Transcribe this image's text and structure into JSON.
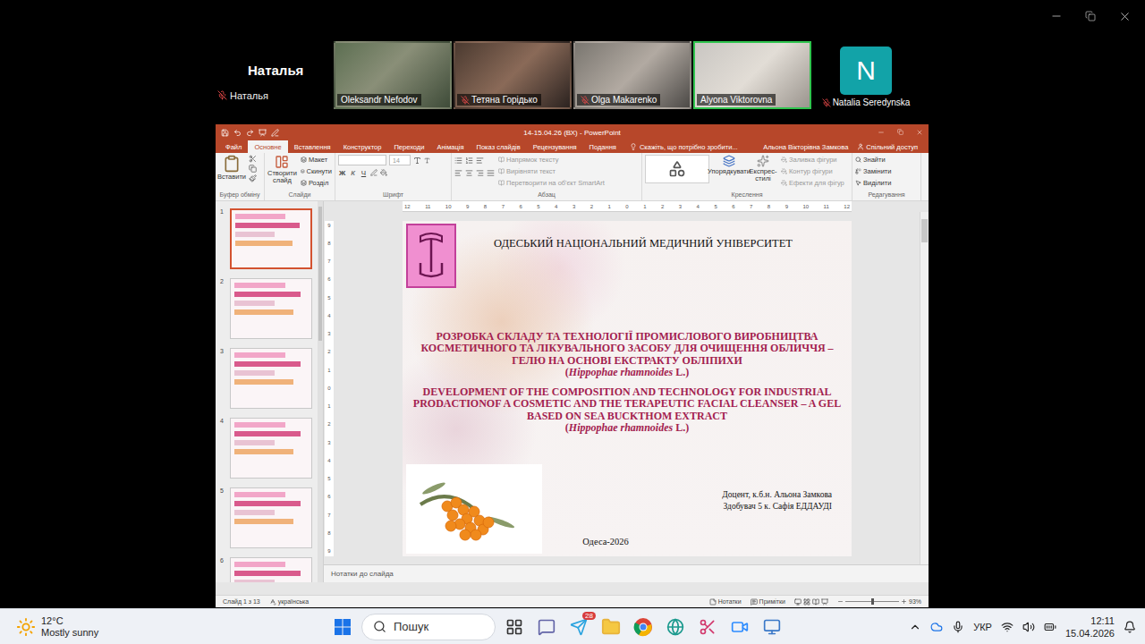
{
  "host": {
    "name": "Наталья",
    "label": "Наталья",
    "muted": true
  },
  "participants": [
    {
      "name": "Oleksandr Nefodov",
      "kind": "video",
      "muted": false,
      "speaking": false
    },
    {
      "name": "Тетяна Горідько",
      "kind": "video",
      "muted": true,
      "speaking": false
    },
    {
      "name": "Olga Makarenko",
      "kind": "video",
      "muted": true,
      "speaking": false
    },
    {
      "name": "Alyona Viktorovna",
      "kind": "video",
      "muted": false,
      "speaking": true
    },
    {
      "name": "Natalia Seredynska",
      "kind": "avatar",
      "initial": "N",
      "muted": true,
      "speaking": false
    }
  ],
  "powerpoint": {
    "title": "14-15.04.26 (ВХ) - PowerPoint",
    "tabs": [
      {
        "label": "Файл",
        "selected": false
      },
      {
        "label": "Основне",
        "selected": true
      },
      {
        "label": "Вставлення",
        "selected": false
      },
      {
        "label": "Конструктор",
        "selected": false
      },
      {
        "label": "Переходи",
        "selected": false
      },
      {
        "label": "Анімація",
        "selected": false
      },
      {
        "label": "Показ слайдів",
        "selected": false
      },
      {
        "label": "Рецензування",
        "selected": false
      },
      {
        "label": "Подання",
        "selected": false
      }
    ],
    "tell_me": "Скажіть, що потрібно зробити...",
    "user": "Альона Вікторівна Замкова",
    "share": "Спільний доступ",
    "ribbon": {
      "clipboard": {
        "label": "Буфер обміну",
        "paste": "Вставити"
      },
      "slides": {
        "label": "Слайди",
        "new_slide": "Створити слайд",
        "items": [
          {
            "label": "Макет",
            "disabled": false
          },
          {
            "label": "Скинути",
            "disabled": false
          },
          {
            "label": "Розділ",
            "disabled": false
          }
        ]
      },
      "font": {
        "label": "Шрифт",
        "size": "14",
        "keys": [
          "Ж",
          "К",
          "Ч"
        ]
      },
      "paragraph": {
        "label": "Абзац",
        "items": [
          {
            "label": "Напрямок тексту",
            "disabled": true
          },
          {
            "label": "Вирівняти текст",
            "disabled": true
          },
          {
            "label": "Перетворити на об'єкт SmartArt",
            "disabled": true
          }
        ]
      },
      "drawing": {
        "label": "Креслення",
        "arrange": "Упорядкувати",
        "quick_styles": "Експрес-стилі",
        "items": [
          {
            "label": "Заливка фігури",
            "disabled": true
          },
          {
            "label": "Контур фігури",
            "disabled": true
          },
          {
            "label": "Ефекти для фігур",
            "disabled": true
          }
        ]
      },
      "editing": {
        "label": "Редагування",
        "items": [
          {
            "label": "Знайти",
            "disabled": false
          },
          {
            "label": "Замінити",
            "disabled": false
          },
          {
            "label": "Виділити",
            "disabled": false
          }
        ]
      }
    },
    "thumbnails": [
      {
        "number": "1",
        "selected": true
      },
      {
        "number": "2",
        "selected": false
      },
      {
        "number": "3",
        "selected": false
      },
      {
        "number": "4",
        "selected": false
      },
      {
        "number": "5",
        "selected": false
      },
      {
        "number": "6",
        "selected": false
      }
    ],
    "ruler": {
      "horizontal": [
        "12",
        "11",
        "10",
        "9",
        "8",
        "7",
        "6",
        "5",
        "4",
        "3",
        "2",
        "1",
        "0",
        "1",
        "2",
        "3",
        "4",
        "5",
        "6",
        "7",
        "8",
        "9",
        "10",
        "11",
        "12"
      ],
      "vertical": [
        "9",
        "8",
        "7",
        "6",
        "5",
        "4",
        "3",
        "2",
        "1",
        "0",
        "1",
        "2",
        "3",
        "4",
        "5",
        "6",
        "7",
        "8",
        "9"
      ]
    },
    "slide": {
      "university": "ОДЕСЬКИЙ НАЦІОНАЛЬНИЙ МЕДИЧНИЙ УНІВЕРСИТЕТ",
      "title_uk": {
        "text": "РОЗРОБКА СКЛАДУ ТА ТЕХНОЛОГІЇ ПРОМИСЛОВОГО ВИРОБНИЦТВА КОСМЕТИЧНОГО ТА ЛІКУВАЛЬНОГО ЗАСОБУ ДЛЯ ОЧИЩЕННЯ ОБЛИЧЧЯ – ГЕЛЮ НА ОСНОВІ ЕКСТРАКТУ ОБЛІПИХИ",
        "open": "(",
        "latin": "Hippophae rhamnoides",
        "close": " L.)"
      },
      "title_en": {
        "text": "DEVELOPMENT OF THE COMPOSITION AND TECHNOLOGY FOR INDUSTRIAL PRODACTIONOF A COSMETIC AND THE TERAPEUTIC FACIAL CLEANSER – A GEL BASED ON SEA BUCKTHOM EXTRACT",
        "open": "(",
        "latin": "Hippophae rhamnoides",
        "close": " L.)"
      },
      "authors": [
        "Доцент, к.б.н. Альона Замкова",
        "Здобувач 5 к. Сафія ЕДДАУДІ"
      ],
      "city": "Одеса-2026"
    },
    "notes": "Нотатки до слайда",
    "status": {
      "slide": "Слайд 1 з 13",
      "language": "українська",
      "notes": "Нотатки",
      "comments": "Примітки",
      "zoom": "93%",
      "zoom_level": 0.5
    }
  },
  "taskbar": {
    "temperature": "12°C",
    "weather": "Mostly sunny",
    "search": "Пошук",
    "badge": "28",
    "language": "УКР",
    "time": "12:11",
    "date": "15.04.2026"
  }
}
